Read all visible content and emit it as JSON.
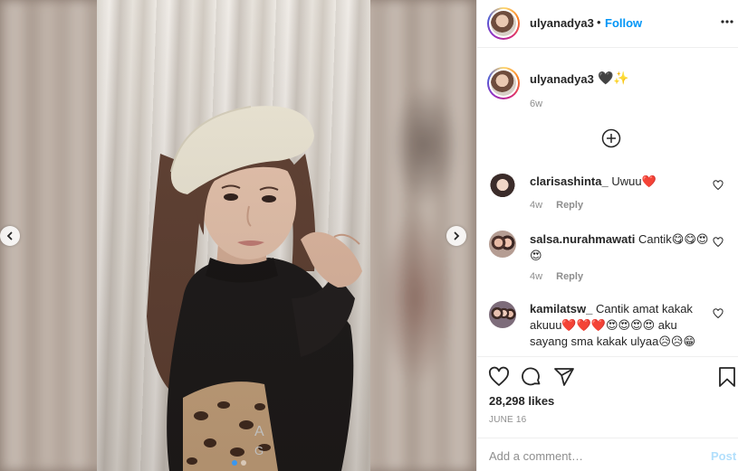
{
  "post": {
    "username": "ulyanadya3",
    "follow_label": "Follow",
    "separator": "•",
    "more_icon": "more-horizontal-icon",
    "caption_emoji": "🖤✨",
    "caption_time": "6w",
    "load_more_icon": "plus-circle-icon",
    "carousel": {
      "slide": 1,
      "total": 2
    }
  },
  "comments": [
    {
      "username": "clarisashinta_",
      "text": "Uwuu❤️",
      "time": "4w",
      "reply_label": "Reply"
    },
    {
      "username": "salsa.nurahmawati",
      "text": "Cantik😋😋😍😍",
      "time": "4w",
      "reply_label": "Reply"
    },
    {
      "username": "kamilatsw_",
      "text": "Cantik amat kakak akuuu❤️❤️❤️😍😍😍😍 aku sayang sma kakak ulyaa😥😥😁"
    }
  ],
  "actions": {
    "likes": "28,298 likes",
    "date": "JUNE 16",
    "add_comment_placeholder": "Add a comment…",
    "post_label": "Post",
    "side_a": "A",
    "side_g": "G"
  },
  "colors": {
    "link_blue": "#0095f6",
    "post_disabled": "#b2dffc",
    "muted": "#8e8e8e"
  }
}
